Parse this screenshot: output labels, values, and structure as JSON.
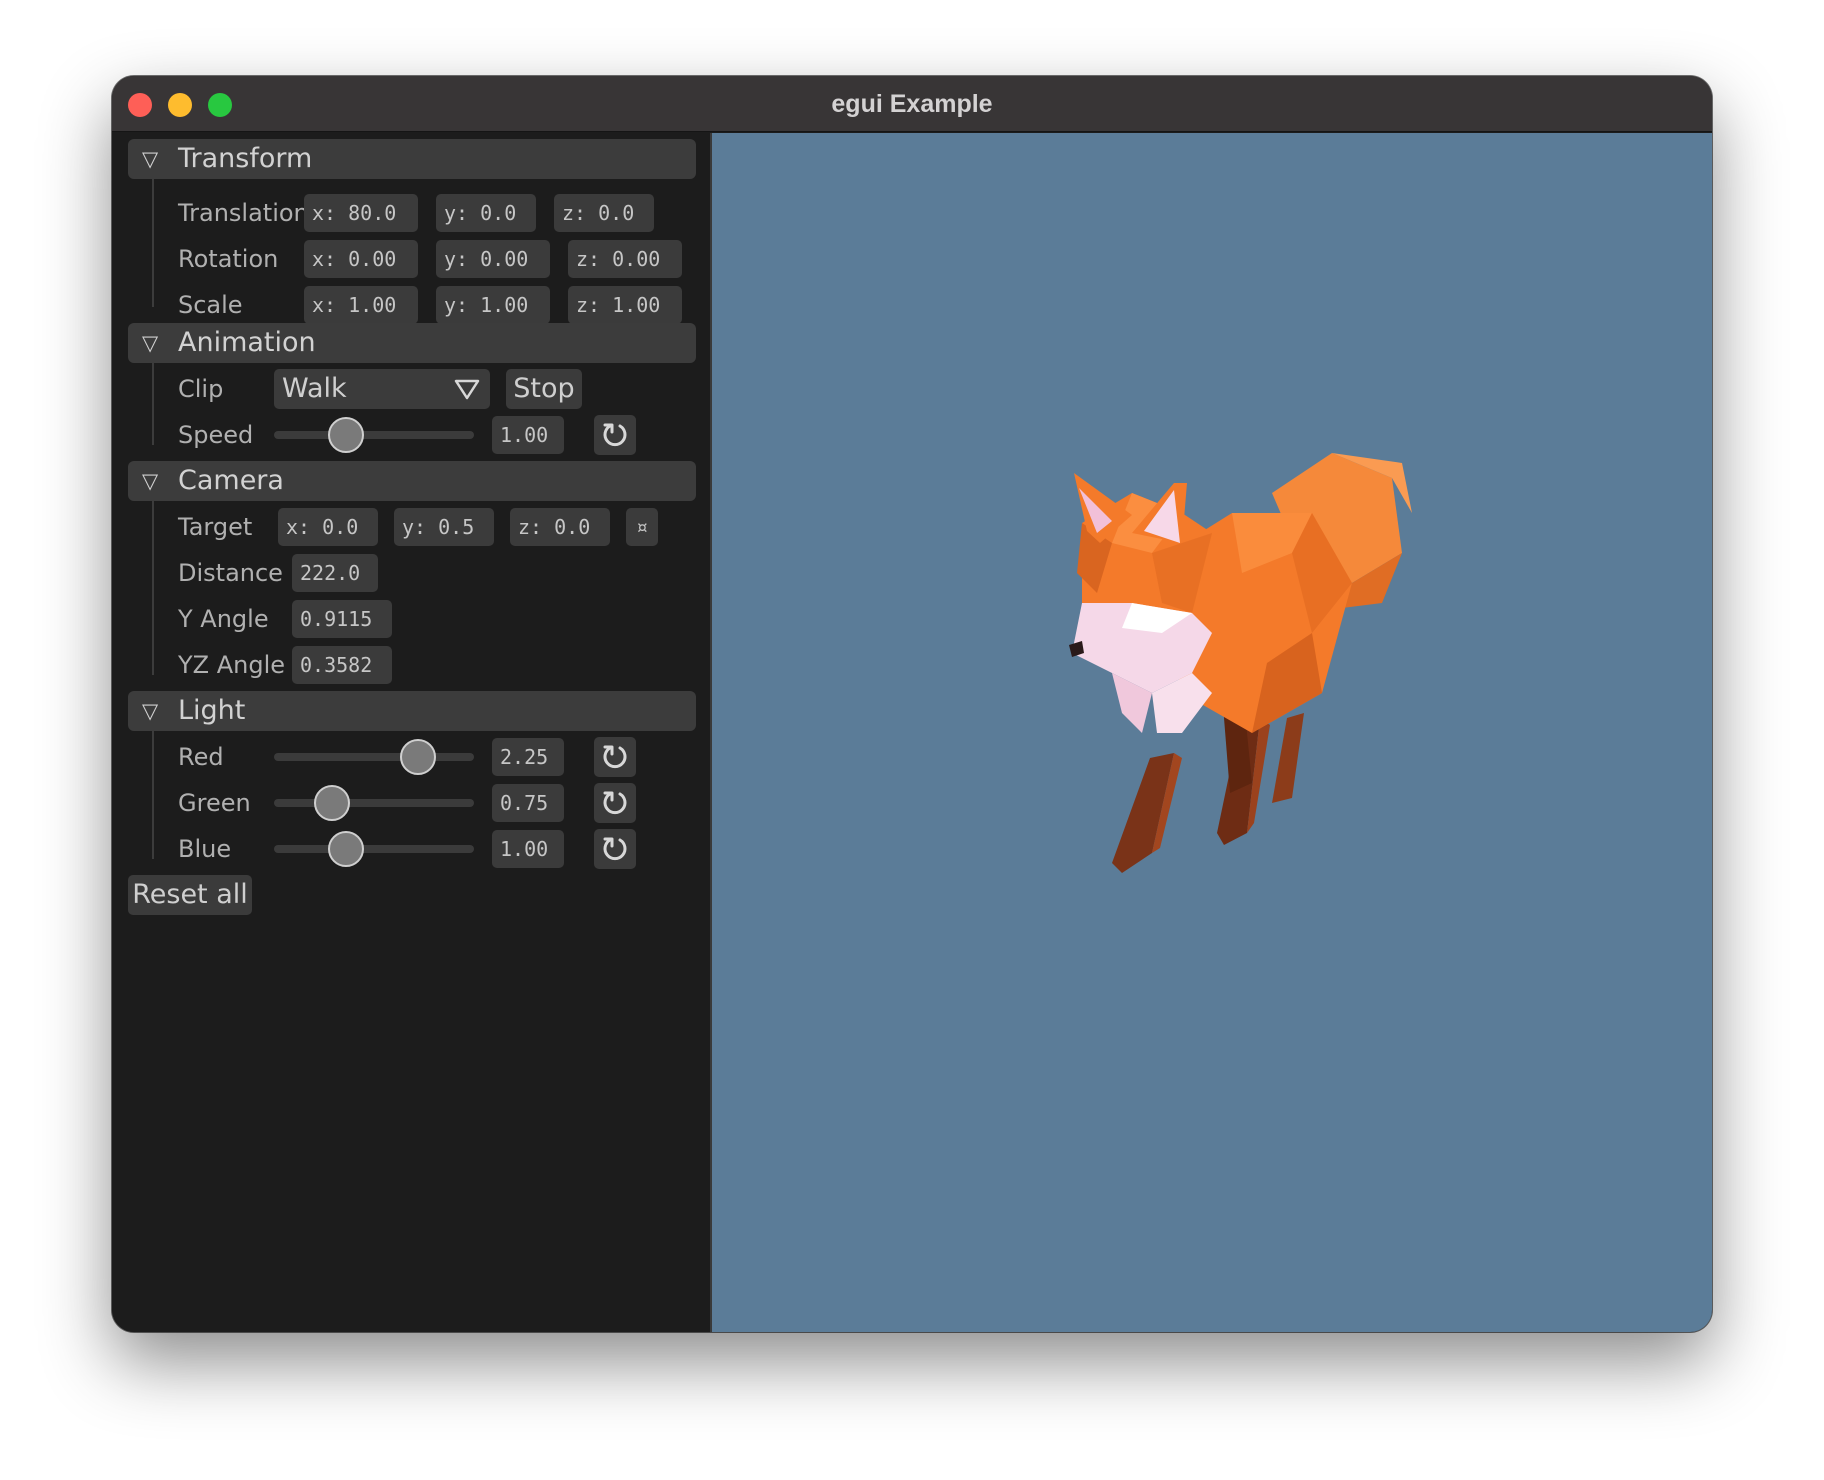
{
  "window": {
    "title": "egui Example"
  },
  "transform": {
    "header": "Transform",
    "translation": {
      "label": "Translation",
      "x": "x: 80.0",
      "y": "y: 0.0",
      "z": "z: 0.0"
    },
    "rotation": {
      "label": "Rotation",
      "x": "x: 0.00",
      "y": "y: 0.00",
      "z": "z: 0.00"
    },
    "scale": {
      "label": "Scale",
      "x": "x: 1.00",
      "y": "y: 1.00",
      "z": "z: 1.00"
    }
  },
  "animation": {
    "header": "Animation",
    "clip": {
      "label": "Clip",
      "selected": "Walk",
      "stop_label": "Stop"
    },
    "speed": {
      "label": "Speed",
      "value": "1.00",
      "slider_fraction": 0.36
    }
  },
  "camera": {
    "header": "Camera",
    "target": {
      "label": "Target",
      "x": "x: 0.0",
      "y": "y: 0.5",
      "z": "z: 0.0",
      "button": "¤"
    },
    "distance": {
      "label": "Distance",
      "value": "222.0"
    },
    "y_angle": {
      "label": "Y Angle",
      "value": "0.9115"
    },
    "yz_angle": {
      "label": "YZ Angle",
      "value": "0.3582"
    }
  },
  "light": {
    "header": "Light",
    "red": {
      "label": "Red",
      "value": "2.25",
      "slider_fraction": 0.72
    },
    "green": {
      "label": "Green",
      "value": "0.75",
      "slider_fraction": 0.29
    },
    "blue": {
      "label": "Blue",
      "value": "1.00",
      "slider_fraction": 0.36
    }
  },
  "reset_all_label": "Reset all",
  "colors": {
    "panel_bg": "#1c1c1c",
    "viewport_bg": "#5b7c98",
    "widget_bg": "#3b3b3b",
    "fox_orange": "#f47a2a",
    "fox_white": "#f5d8e8",
    "fox_legs": "#8a3a1c"
  },
  "icons": {
    "collapse": "triangle-down-icon",
    "reset": "reset-arrow-icon",
    "dropdown": "dropdown-triangle-icon"
  }
}
